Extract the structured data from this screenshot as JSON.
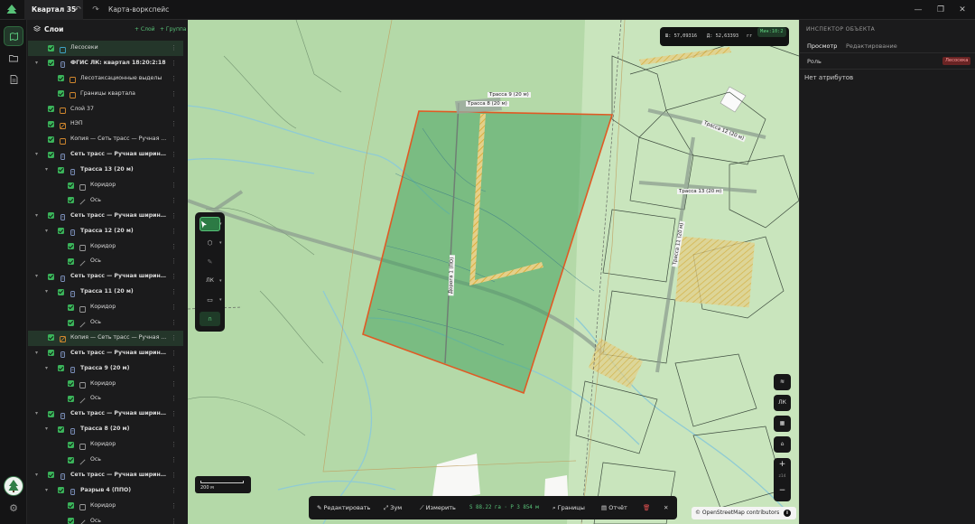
{
  "titlebar": {
    "tab_title": "Квартал 35",
    "workspace_title": "Карта-воркспейс"
  },
  "layers_panel": {
    "title": "Слои",
    "add_layer": "+ Слой",
    "add_group": "+ Группа",
    "items": [
      {
        "label": "Лесосеки",
        "depth": 0,
        "type": "folder",
        "icon_color": "#3fa4c7",
        "highlighted": true
      },
      {
        "label": "ФГИС ЛК: квартал 18:20:2:18",
        "depth": 0,
        "type": "service",
        "bold": true
      },
      {
        "label": "Лесотаксационные выделы",
        "depth": 1,
        "type": "area",
        "icon_color": "#d4892e"
      },
      {
        "label": "Границы квартала",
        "depth": 1,
        "type": "area",
        "icon_color": "#d4892e"
      },
      {
        "label": "Слой 37",
        "depth": 0,
        "type": "area",
        "icon_color": "#d4892e"
      },
      {
        "label": "НЭП",
        "depth": 0,
        "type": "hatched",
        "icon_color": "#d4892e"
      },
      {
        "label": "Копия — Сеть трасс — Ручная ...",
        "depth": 0,
        "type": "area",
        "icon_color": "#d4892e"
      },
      {
        "label": "Сеть трасс — Ручная ширина, ...",
        "depth": 0,
        "type": "network",
        "bold": true
      },
      {
        "label": "Трасса 13 (20 м)",
        "depth": 1,
        "type": "network",
        "bold": true
      },
      {
        "label": "Коридор",
        "depth": 2,
        "type": "corridor"
      },
      {
        "label": "Ось",
        "depth": 2,
        "type": "axis"
      },
      {
        "label": "Сеть трасс — Ручная ширина, ...",
        "depth": 0,
        "type": "network",
        "bold": true
      },
      {
        "label": "Трасса 12 (20 м)",
        "depth": 1,
        "type": "network",
        "bold": true
      },
      {
        "label": "Коридор",
        "depth": 2,
        "type": "corridor"
      },
      {
        "label": "Ось",
        "depth": 2,
        "type": "axis"
      },
      {
        "label": "Сеть трасс — Ручная ширина, ...",
        "depth": 0,
        "type": "network",
        "bold": true
      },
      {
        "label": "Трасса 11 (20 м)",
        "depth": 1,
        "type": "network",
        "bold": true
      },
      {
        "label": "Коридор",
        "depth": 2,
        "type": "corridor"
      },
      {
        "label": "Ось",
        "depth": 2,
        "type": "axis"
      },
      {
        "label": "Копия — Сеть трасс — Ручная ...",
        "depth": 0,
        "type": "hatched",
        "icon_color": "#d4892e",
        "highlighted": true
      },
      {
        "label": "Сеть трасс — Ручная ширина, ...",
        "depth": 0,
        "type": "network",
        "bold": true
      },
      {
        "label": "Трасса 9 (20 м)",
        "depth": 1,
        "type": "network",
        "bold": true
      },
      {
        "label": "Коридор",
        "depth": 2,
        "type": "corridor"
      },
      {
        "label": "Ось",
        "depth": 2,
        "type": "axis"
      },
      {
        "label": "Сеть трасс — Ручная ширина, ...",
        "depth": 0,
        "type": "network",
        "bold": true
      },
      {
        "label": "Трасса 8 (20 м)",
        "depth": 1,
        "type": "network",
        "bold": true
      },
      {
        "label": "Коридор",
        "depth": 2,
        "type": "corridor"
      },
      {
        "label": "Ось",
        "depth": 2,
        "type": "axis"
      },
      {
        "label": "Сеть трасс — Ручная ширина, ...",
        "depth": 0,
        "type": "network",
        "bold": true
      },
      {
        "label": "Разрыв 4 (ППО)",
        "depth": 1,
        "type": "network",
        "bold": true
      },
      {
        "label": "Коридор",
        "depth": 2,
        "type": "corridor"
      },
      {
        "label": "Ось",
        "depth": 2,
        "type": "axis"
      }
    ]
  },
  "map": {
    "coords": {
      "lat": "Ш: 57,09316",
      "lon": "Д: 52,63393",
      "unit": "гг",
      "scale": "Мин:10:2"
    },
    "labels": [
      "Трасса 9 (20 м)",
      "Трасса 8 (20 м)",
      "Трасса 12 (20 м)",
      "Трасса 13 (20 м)",
      "Трасса 11 (20 м)",
      "Дорога 1 (ПО)"
    ],
    "toolbox": {
      "lk_label": "ЛК"
    },
    "scalebar": "200 м",
    "right_controls": {
      "lk_label": "ЛК",
      "zoom_level": "z14"
    },
    "attribution": "© OpenStreetMap contributors",
    "colors": {
      "selection_outline": "#e05a24",
      "selection_fill": "#3f9f5b",
      "hatch": "#d9a62c",
      "road": "#8a9a8e"
    }
  },
  "actionbar": {
    "edit": "Редактировать",
    "zoom": "Зум",
    "measure": "Измерить",
    "measure_value": "S 88.22 га · P 3 854 м",
    "bounds": "Границы",
    "report": "Отчёт"
  },
  "inspector": {
    "title": "ИНСПЕКТОР ОБЪЕКТА",
    "tab_view": "Просмотр",
    "tab_edit": "Редактирование",
    "role_label": "Роль",
    "role_value": "Лесосека",
    "no_attributes": "Нет атрибутов"
  }
}
